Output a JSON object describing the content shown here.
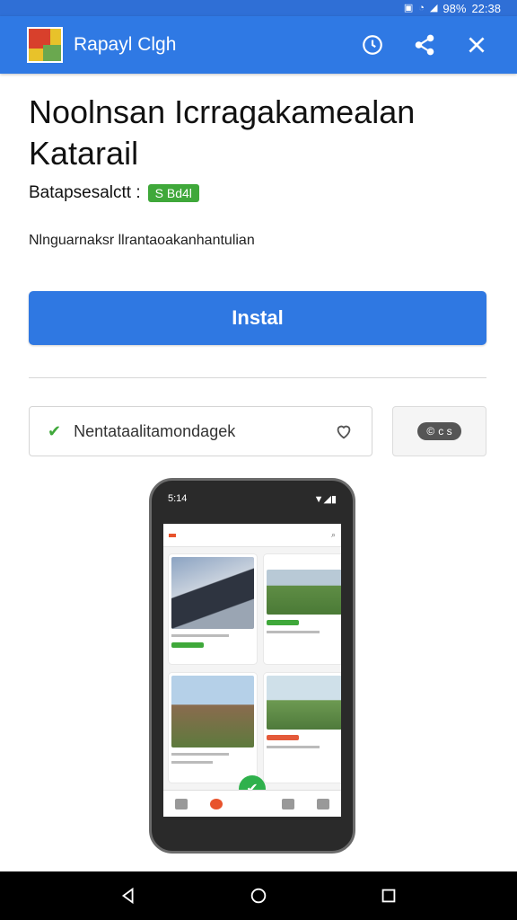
{
  "status_bar": {
    "battery": "98%",
    "time": "22:38"
  },
  "app_bar": {
    "title": "Rapayl Clgh",
    "icons": [
      "history-icon",
      "share-icon",
      "close-icon"
    ]
  },
  "main": {
    "headline": "Noolnsan Icrragakamealan Katarail",
    "meta_label": "Batapsesalctt :",
    "badge": "S Bd4l",
    "description": "Nlnguarnaksr llrantaoakanhantulian",
    "install_label": "Instal",
    "info_card_label": "Nentataalitamondagek",
    "side_pill": "c s"
  },
  "phone": {
    "status_time": "5:14",
    "status_right": "▼◢▮"
  },
  "colors": {
    "primary": "#2f79e4",
    "accent_green": "#3fa83a"
  }
}
